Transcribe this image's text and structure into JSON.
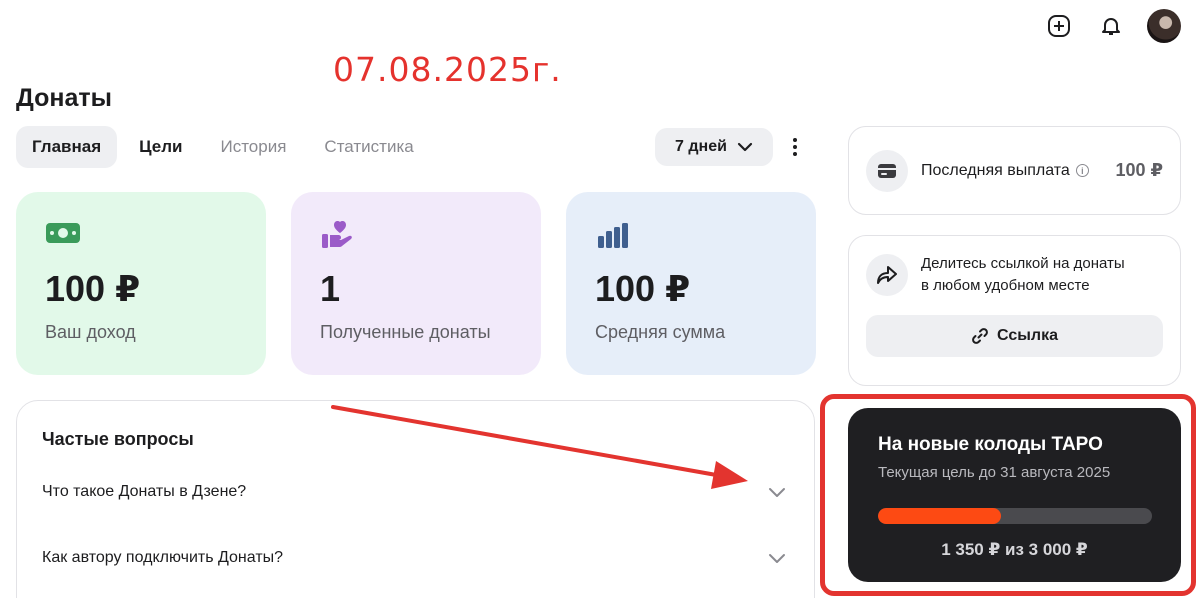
{
  "header": {
    "add_icon": "plus-square-icon",
    "bell_icon": "bell-icon",
    "avatar": "user-avatar"
  },
  "annotation": {
    "date": "07.08.2025г.",
    "color": "#e5322d"
  },
  "page": {
    "title": "Донаты"
  },
  "tabs": [
    {
      "label": "Главная",
      "active": true
    },
    {
      "label": "Цели",
      "active": false
    },
    {
      "label": "История",
      "active": false
    },
    {
      "label": "Статистика",
      "active": false
    }
  ],
  "period": {
    "value": "7 дней"
  },
  "stats": [
    {
      "value": "100 ₽",
      "label": "Ваш доход",
      "icon": "money-icon",
      "color": "#e2f9e9"
    },
    {
      "value": "1",
      "label": "Полученные донаты",
      "icon": "hand-heart-icon",
      "color": "#f2eafa"
    },
    {
      "value": "100 ₽",
      "label": "Средняя сумма",
      "icon": "bar-chart-icon",
      "color": "#e6eef9"
    }
  ],
  "faq": {
    "title": "Частые вопросы",
    "items": [
      {
        "question": "Что такое Донаты в Дзене?"
      },
      {
        "question": "Как автору подключить Донаты?"
      }
    ]
  },
  "payout": {
    "label": "Последняя выплата",
    "amount": "100 ₽"
  },
  "share": {
    "text_line1": "Делитесь ссылкой на донаты",
    "text_line2": "в любом удобном месте",
    "button_label": "Ссылка"
  },
  "goal": {
    "title": "На новые колоды ТАРО",
    "subtitle": "Текущая цель до 31 августа 2025",
    "amount_text": "1 350 ₽ из 3 000 ₽",
    "progress_fraction": 0.45,
    "accent": "#fd4a13"
  }
}
